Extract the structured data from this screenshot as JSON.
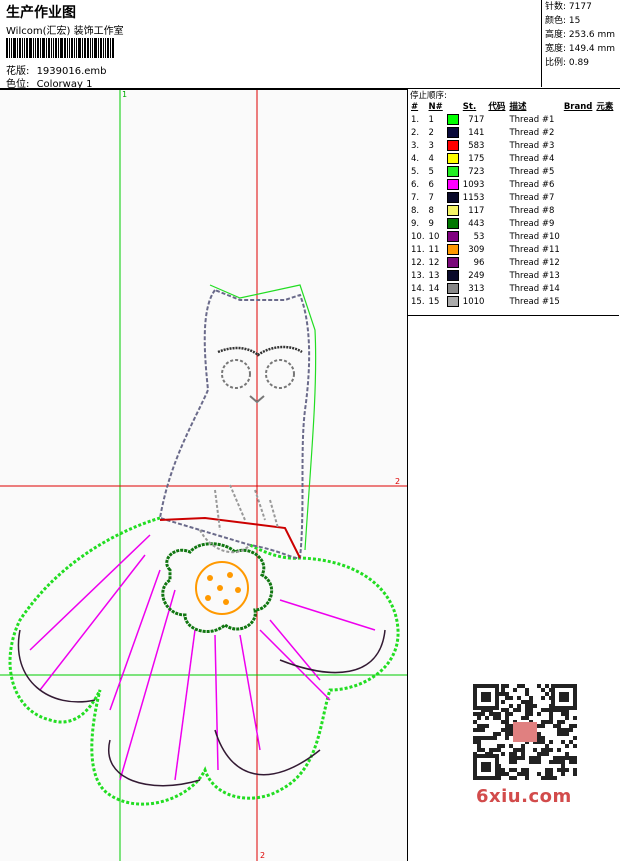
{
  "header": {
    "title": "生产作业图",
    "subtitle": "Wilcom(汇宏) 装饰工作室",
    "design_label": "花版:",
    "design_file": "1939016.emb",
    "colorway_label": "色位:",
    "colorway": "Colorway 1"
  },
  "stats": {
    "stitches": "针数: 7177",
    "colors": "颜色: 15",
    "height": "高度: 253.6 mm",
    "width": "宽度: 149.4 mm",
    "scale": "比例: 0.89"
  },
  "canvas": {
    "marker_top": "1",
    "marker_right": "2",
    "marker_bottom": "2"
  },
  "panel": {
    "title": "停止顺序:",
    "columns": [
      "#",
      "N#",
      "St.",
      "代码",
      "描述",
      "Brand",
      "元素"
    ],
    "rows": [
      {
        "n": "1.",
        "nn": "1",
        "color": "#00ff00",
        "st": "717",
        "desc": "Thread #1"
      },
      {
        "n": "2.",
        "nn": "2",
        "color": "#0a0a3a",
        "st": "141",
        "desc": "Thread #2"
      },
      {
        "n": "3.",
        "nn": "3",
        "color": "#ff0000",
        "st": "583",
        "desc": "Thread #3"
      },
      {
        "n": "4.",
        "nn": "4",
        "color": "#ffff00",
        "st": "175",
        "desc": "Thread #4"
      },
      {
        "n": "5.",
        "nn": "5",
        "color": "#22ee22",
        "st": "723",
        "desc": "Thread #5"
      },
      {
        "n": "6.",
        "nn": "6",
        "color": "#ff00ff",
        "st": "1093",
        "desc": "Thread #6"
      },
      {
        "n": "7.",
        "nn": "7",
        "color": "#0a0a2a",
        "st": "1153",
        "desc": "Thread #7"
      },
      {
        "n": "8.",
        "nn": "8",
        "color": "#f4f466",
        "st": "117",
        "desc": "Thread #8"
      },
      {
        "n": "9.",
        "nn": "9",
        "color": "#007700",
        "st": "443",
        "desc": "Thread #9"
      },
      {
        "n": "10.",
        "nn": "10",
        "color": "#800080",
        "st": "53",
        "desc": "Thread #10"
      },
      {
        "n": "11.",
        "nn": "11",
        "color": "#ff9900",
        "st": "309",
        "desc": "Thread #11"
      },
      {
        "n": "12.",
        "nn": "12",
        "color": "#7a0a7a",
        "st": "96",
        "desc": "Thread #12"
      },
      {
        "n": "13.",
        "nn": "13",
        "color": "#0a0a2a",
        "st": "249",
        "desc": "Thread #13"
      },
      {
        "n": "14.",
        "nn": "14",
        "color": "#888888",
        "st": "313",
        "desc": "Thread #14"
      },
      {
        "n": "15.",
        "nn": "15",
        "color": "#aaaaaa",
        "st": "1010",
        "desc": "Thread #15"
      }
    ]
  },
  "watermark": "6xiu.com"
}
